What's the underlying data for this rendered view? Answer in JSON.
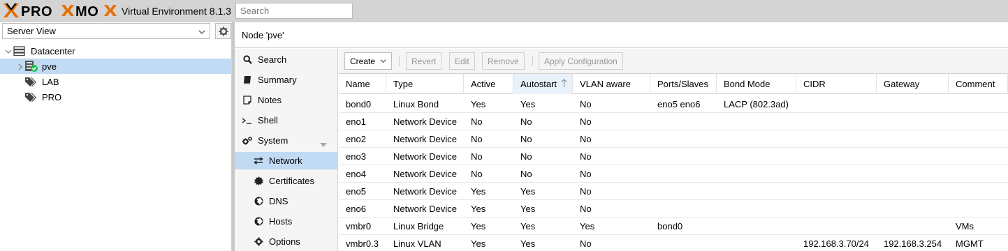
{
  "topbar": {
    "brand": "PROXMOX",
    "product": "Virtual Environment 8.1.3",
    "search_placeholder": "Search"
  },
  "left": {
    "view_select": "Server View",
    "tree": [
      {
        "label": "Datacenter",
        "icon": "server-rack-icon",
        "expanded": true
      },
      {
        "label": "pve",
        "icon": "node-online-icon",
        "selected": true
      },
      {
        "label": "LAB",
        "icon": "tags-icon"
      },
      {
        "label": "PRO",
        "icon": "tags-icon"
      }
    ]
  },
  "main": {
    "title": "Node 'pve'",
    "menu": [
      {
        "label": "Search",
        "icon": "search-icon"
      },
      {
        "label": "Summary",
        "icon": "book-icon"
      },
      {
        "label": "Notes",
        "icon": "note-icon"
      },
      {
        "label": "Shell",
        "icon": "terminal-icon"
      },
      {
        "label": "System",
        "icon": "cogs-icon",
        "collapsible": true
      },
      {
        "label": "Network",
        "icon": "exchange-icon",
        "selected": true
      },
      {
        "label": "Certificates",
        "icon": "certificate-icon"
      },
      {
        "label": "DNS",
        "icon": "globe-icon"
      },
      {
        "label": "Hosts",
        "icon": "globe-icon"
      },
      {
        "label": "Options",
        "icon": "gear-icon"
      }
    ],
    "toolbar": {
      "create": "Create",
      "revert": "Revert",
      "edit": "Edit",
      "remove": "Remove",
      "apply": "Apply Configuration"
    },
    "columns": [
      "Name",
      "Type",
      "Active",
      "Autostart",
      "VLAN aware",
      "Ports/Slaves",
      "Bond Mode",
      "CIDR",
      "Gateway",
      "Comment"
    ],
    "sorted_column": "Autostart",
    "rows": [
      [
        "bond0",
        "Linux Bond",
        "Yes",
        "Yes",
        "No",
        "eno5 eno6",
        "LACP (802.3ad)",
        "",
        "",
        ""
      ],
      [
        "eno1",
        "Network Device",
        "No",
        "No",
        "No",
        "",
        "",
        "",
        "",
        ""
      ],
      [
        "eno2",
        "Network Device",
        "No",
        "No",
        "No",
        "",
        "",
        "",
        "",
        ""
      ],
      [
        "eno3",
        "Network Device",
        "No",
        "No",
        "No",
        "",
        "",
        "",
        "",
        ""
      ],
      [
        "eno4",
        "Network Device",
        "No",
        "No",
        "No",
        "",
        "",
        "",
        "",
        ""
      ],
      [
        "eno5",
        "Network Device",
        "Yes",
        "Yes",
        "No",
        "",
        "",
        "",
        "",
        ""
      ],
      [
        "eno6",
        "Network Device",
        "Yes",
        "Yes",
        "No",
        "",
        "",
        "",
        "",
        ""
      ],
      [
        "vmbr0",
        "Linux Bridge",
        "Yes",
        "Yes",
        "Yes",
        "bond0",
        "",
        "",
        "",
        "VMs"
      ],
      [
        "vmbr0.3",
        "Linux VLAN",
        "Yes",
        "Yes",
        "No",
        "",
        "",
        "192.168.3.70/24",
        "192.168.3.254",
        "MGMT"
      ]
    ]
  },
  "colors": {
    "accent_orange": "#e57000",
    "selection": "#c0dbf3",
    "topbar": "#d4d4d4"
  }
}
